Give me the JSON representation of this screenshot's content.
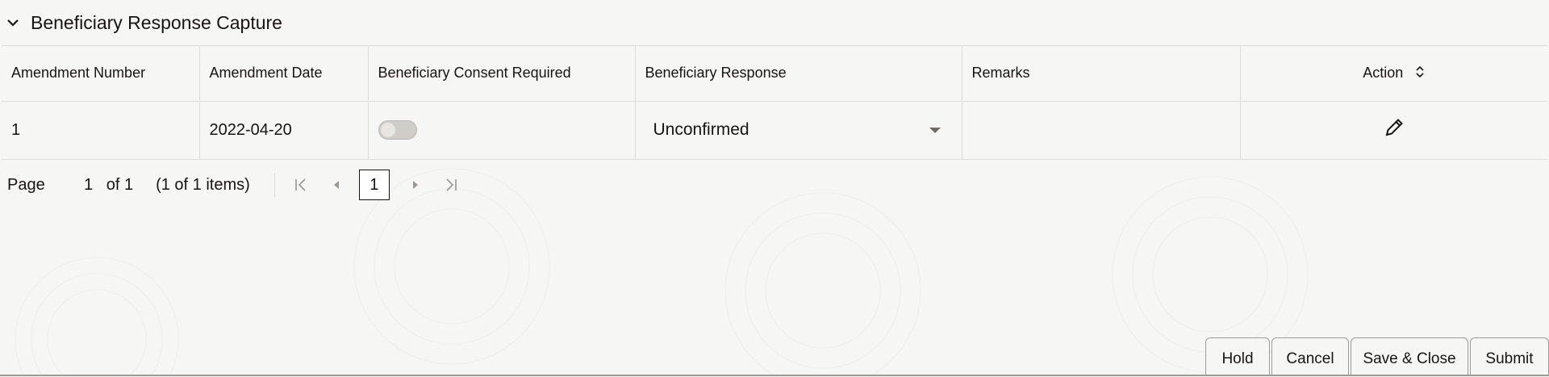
{
  "section": {
    "title": "Beneficiary Response Capture",
    "toggle_icon": "chevron-down-icon"
  },
  "grid": {
    "columns": [
      "Amendment Number",
      "Amendment Date",
      "Beneficiary Consent Required",
      "Beneficiary Response",
      "Remarks",
      "Action"
    ],
    "rows": [
      {
        "amendment_number": "1",
        "amendment_date": "2022-04-20",
        "consent_required": false,
        "beneficiary_response": "Unconfirmed",
        "remarks": "",
        "action_icon": "edit-pencil-icon"
      }
    ]
  },
  "pagination": {
    "page_label": "Page",
    "current_page": "1",
    "of_label": "of 1",
    "items_summary": "(1 of 1 items)",
    "page_button": "1"
  },
  "footer": {
    "hold": "Hold",
    "cancel": "Cancel",
    "save_close": "Save & Close",
    "submit": "Submit"
  }
}
